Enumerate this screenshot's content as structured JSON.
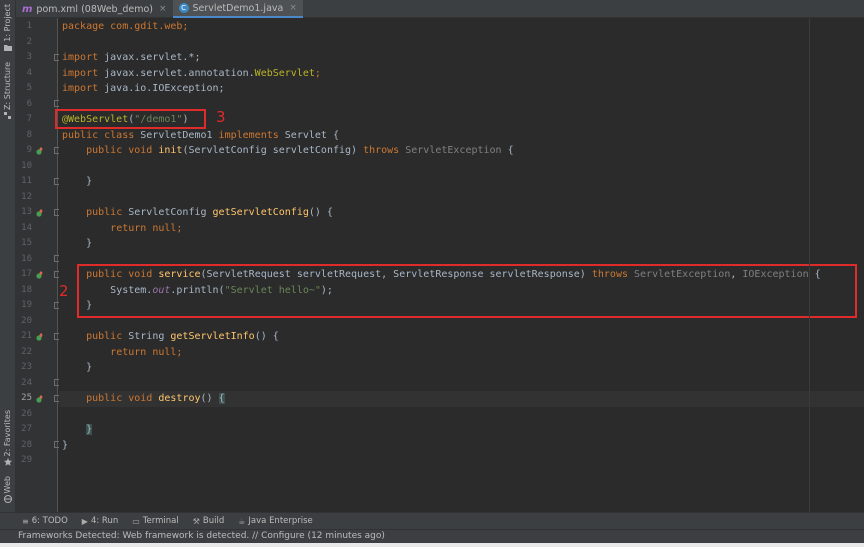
{
  "tabs": [
    {
      "icon": "m",
      "label": "pom.xml (08Web_demo)",
      "close": "×"
    },
    {
      "icon": "C",
      "label": "ServletDemo1.java",
      "close": "×"
    }
  ],
  "left_tools": [
    "1: Project",
    "Z: Structure",
    "2: Favorites",
    "Web"
  ],
  "line_numbers": [
    "1",
    "2",
    "3",
    "4",
    "5",
    "6",
    "7",
    "8",
    "9",
    "10",
    "11",
    "12",
    "13",
    "14",
    "15",
    "16",
    "17",
    "18",
    "19",
    "20",
    "21",
    "22",
    "23",
    "24",
    "25",
    "26",
    "27",
    "28",
    "29"
  ],
  "code": {
    "l1": [
      "package com.gdit.web;"
    ],
    "l3": [
      "import",
      " javax.servlet.*;"
    ],
    "l4": [
      "import",
      " javax.servlet.annotation.",
      "WebServlet",
      ";"
    ],
    "l5": [
      "import",
      " java.io.IOException;"
    ],
    "l7": [
      "@WebServlet",
      "(",
      "\"/demo1\"",
      ")"
    ],
    "l8": [
      "public class",
      " ServletDemo1 ",
      "implements",
      " Servlet {"
    ],
    "l9": [
      "public void",
      " ",
      "init",
      "(ServletConfig servletConfig) ",
      "throws",
      " ",
      "ServletException",
      " {"
    ],
    "l11": [
      "}"
    ],
    "l13": [
      "public",
      " ServletConfig ",
      "getServletConfig",
      "() {"
    ],
    "l14": [
      "return null",
      ";"
    ],
    "l15": [
      "}"
    ],
    "l17": [
      "public void",
      " ",
      "service",
      "(ServletRequest servletRequest, ServletResponse servletResponse) ",
      "throws",
      " ",
      "ServletException",
      ", ",
      "IOException",
      " {"
    ],
    "l18": [
      "System.",
      "out",
      ".println(",
      "\"Servlet hello~\"",
      ");"
    ],
    "l19": [
      "}"
    ],
    "l21": [
      "public",
      " String ",
      "getServletInfo",
      "() {"
    ],
    "l22": [
      "return null",
      ";"
    ],
    "l23": [
      "}"
    ],
    "l25": [
      "public void",
      " ",
      "destroy",
      "() ",
      "{"
    ],
    "l27": [
      "}"
    ],
    "l28": [
      "}"
    ]
  },
  "annotations": {
    "box3_label": "3",
    "box2_label": "2"
  },
  "bottom_tools": [
    {
      "icon": "≡",
      "label": "6: TODO"
    },
    {
      "icon": "▶",
      "label": "4: Run"
    },
    {
      "icon": "▭",
      "label": "Terminal"
    },
    {
      "icon": "⚒",
      "label": "Build"
    },
    {
      "icon": "☕",
      "label": "Java Enterprise"
    }
  ],
  "status": "Frameworks Detected: Web framework is detected. // Configure (12 minutes ago)",
  "colors": {
    "keyword": "#cc7832",
    "method": "#ffc66d",
    "string": "#6a8759",
    "annotation": "#bbb529",
    "highlight_box": "#e02b2b"
  }
}
